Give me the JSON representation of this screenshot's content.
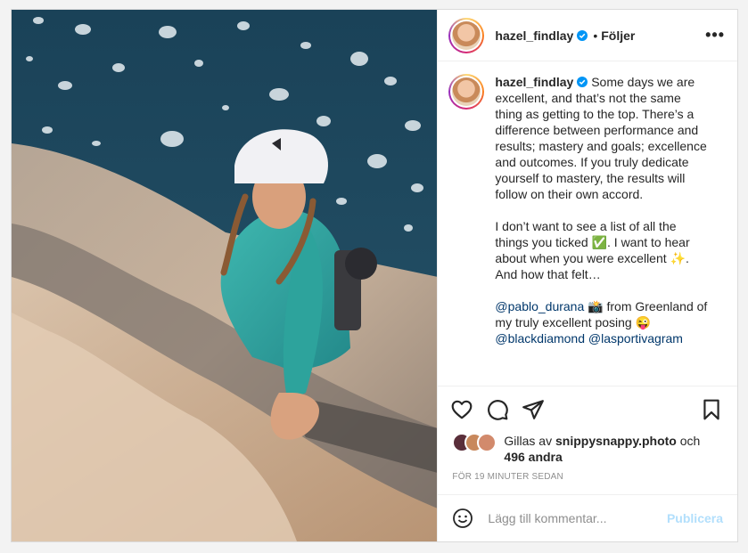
{
  "post": {
    "username": "hazel_findlay",
    "separator": "•",
    "follow_label": "Följer",
    "more_label": "•••",
    "caption_user": "hazel_findlay",
    "caption_para1": "Some days we are excellent, and that’s not the same thing as getting to the top. There’s a difference between performance and results; mastery and goals; excellence and outcomes. If you truly dedicate yourself to mastery, the results will follow on their own accord.",
    "caption_para2": "I don’t want to see a list of all the things you ticked ✅. I want to hear about when you were excellent ✨. And how that felt…",
    "mention_1": "@pablo_durana",
    "caption_from": " 📸 from Greenland of my truly excellent posing 😜",
    "mention_2": "@blackdiamond",
    "mention_3": "@lasportivagram",
    "likes_prefix": "Gillas av ",
    "likes_user": "snippysnappy.photo",
    "likes_and": " och",
    "likes_others": "496 andra",
    "time_ago": "FÖR 19 MINUTER SEDAN",
    "comment_placeholder": "Lägg till kommentar...",
    "publish_label": "Publicera"
  },
  "icons": {
    "verified": "verified-badge-icon",
    "like": "heart-icon",
    "comment": "comment-icon",
    "share": "paper-plane-icon",
    "save": "bookmark-icon",
    "emoji": "smiley-icon"
  },
  "colors": {
    "verified_blue": "#0095f6",
    "mention": "#00376b",
    "publish_disabled": "#b2dffc",
    "meta_grey": "#8e8e8e"
  }
}
